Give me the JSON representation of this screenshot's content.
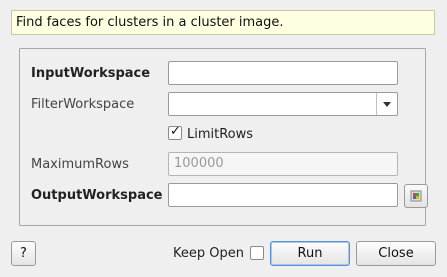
{
  "description": "Find faces for clusters in a cluster image.",
  "fields": {
    "input_workspace": {
      "label": "InputWorkspace",
      "value": ""
    },
    "filter_workspace": {
      "label": "FilterWorkspace",
      "value": ""
    },
    "limit_rows": {
      "label": "LimitRows",
      "checked": true,
      "check_mark": "✓"
    },
    "maximum_rows": {
      "label": "MaximumRows",
      "placeholder": "100000"
    },
    "output_workspace": {
      "label": "OutputWorkspace",
      "value": ""
    }
  },
  "icons": {
    "browse": "workspace-browse-icon",
    "dropdown": "chevron-down-icon",
    "checkmark": "checkmark-icon"
  },
  "footer": {
    "help_label": "?",
    "keep_open_label": "Keep Open",
    "keep_open_checked": false,
    "run_label": "Run",
    "close_label": "Close"
  },
  "colors": {
    "description_bg": "#ffffe1",
    "default_button_border": "#5b8fd0"
  }
}
